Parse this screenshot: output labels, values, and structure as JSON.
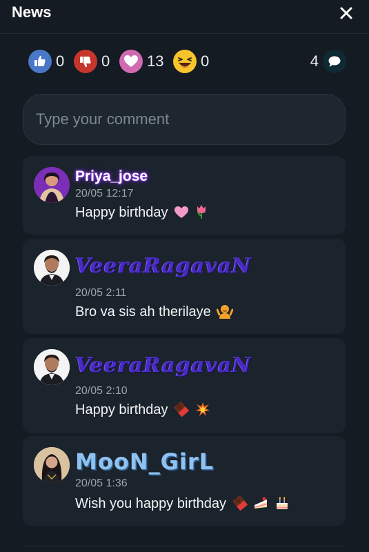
{
  "header": {
    "title": "News",
    "close_icon": "close-icon"
  },
  "reactions": {
    "like": {
      "icon": "thumbs-up-icon",
      "count": "0",
      "color": "#4a78c9"
    },
    "dislike": {
      "icon": "thumbs-down-icon",
      "count": "0",
      "color": "#c7352c"
    },
    "love": {
      "icon": "heart-icon",
      "count": "13",
      "color": "#d06bb2"
    },
    "haha": {
      "icon": "laughing-emoji-icon",
      "count": "0",
      "color": "#f7c52b"
    }
  },
  "comments_total": {
    "count": "4",
    "icon": "speech-bubble-icon"
  },
  "composer": {
    "placeholder": "Type your comment",
    "value": ""
  },
  "comments": [
    {
      "username": "Priya_jose",
      "timestamp": "20/05 12:17",
      "text": "Happy birthday",
      "emojis": [
        "pink-heart-emoji",
        "tulip-emoji"
      ]
    },
    {
      "username": "VeeraRagavaN",
      "timestamp": "20/05 2:11",
      "text": "Bro va sis ah therilaye",
      "emojis": [
        "shrug-emoji"
      ]
    },
    {
      "username": "VeeraRagavaN",
      "timestamp": "20/05 2:10",
      "text": "Happy birthday",
      "emojis": [
        "chocolate-emoji",
        "collision-emoji"
      ]
    },
    {
      "username": "MooN_GirL",
      "timestamp": "20/05 1:36",
      "text": "Wish you happy birthday",
      "emojis": [
        "chocolate-emoji",
        "cake-slice-emoji",
        "birthday-cake-emoji"
      ]
    }
  ]
}
